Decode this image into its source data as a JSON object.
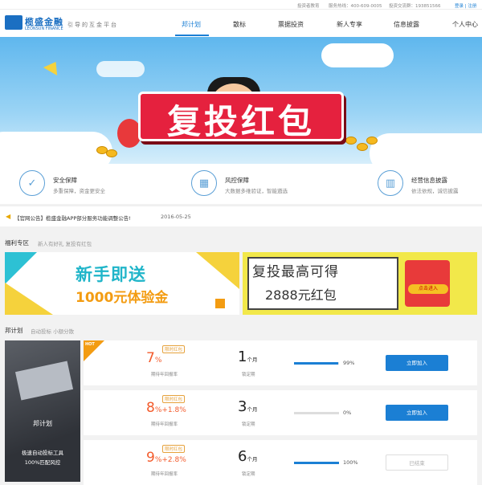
{
  "topbar": {
    "investor_edu": "投资者教育",
    "hotline": "服务热线：400-609-0005",
    "group": "投资交流群：193851566",
    "login": "登录 | 注册"
  },
  "header": {
    "logo_cn": "榄盛金融",
    "logo_en": "LEONSUN FINANCE",
    "slogan": "引导的互金平台",
    "nav": [
      "邦计划",
      "散标",
      "票据投资",
      "新人专享",
      "信息披露",
      "个人中心"
    ]
  },
  "banner": {
    "title": "复投红包"
  },
  "features": [
    {
      "icon": "shield-icon",
      "glyph": "✓",
      "title": "安全保障",
      "sub": "多重保障，资金更安全"
    },
    {
      "icon": "grid-icon",
      "glyph": "▦",
      "title": "风控保障",
      "sub": "大数据多维验证，智能遴选"
    },
    {
      "icon": "chart-icon",
      "glyph": "▥",
      "title": "经营信息披露",
      "sub": "依法依规，诚信披露"
    }
  ],
  "notice": {
    "text": "【官网公告】榄盛金融APP部分服务功能调整公告!",
    "date": "2016-05-25"
  },
  "welfare": {
    "title": "福利专区",
    "sub": "新人有好礼 复投有红包"
  },
  "promo_left": {
    "line1": "新手即送",
    "line2": "1000元体验金"
  },
  "promo_right": {
    "line1": "复投最高可得",
    "line2": "2888元红包",
    "button": "点击进入"
  },
  "plan": {
    "title": "邦计划",
    "sub": "自动投标 小额分散",
    "side_title": "邦计划",
    "side_sub1": "极速自动投标工具",
    "side_sub2": "100%匹配风控"
  },
  "rows": [
    {
      "hot": "HOT",
      "rate_main": "7",
      "rate_suffix": "%",
      "rate_extra": "",
      "badge": "限时红包",
      "rate_label": "期待年回报率",
      "term": "1",
      "term_unit": "个月",
      "term_label": "锁定期",
      "progress": 0.99,
      "pct": "99%",
      "button": "立即加入",
      "disabled": false
    },
    {
      "hot": "",
      "rate_main": "8",
      "rate_suffix": "%",
      "rate_extra": "+1.8%",
      "badge": "限时红包",
      "rate_label": "期待年回报率",
      "term": "3",
      "term_unit": "个月",
      "term_label": "锁定期",
      "progress": 0.0,
      "pct": "0%",
      "button": "立即加入",
      "disabled": false
    },
    {
      "hot": "",
      "rate_main": "9",
      "rate_suffix": "%",
      "rate_extra": "+2.8%",
      "badge": "限时红包",
      "rate_label": "期待年回报率",
      "term": "6",
      "term_unit": "个月",
      "term_label": "锁定期",
      "progress": 1.0,
      "pct": "100%",
      "button": "已结束",
      "disabled": true
    }
  ]
}
